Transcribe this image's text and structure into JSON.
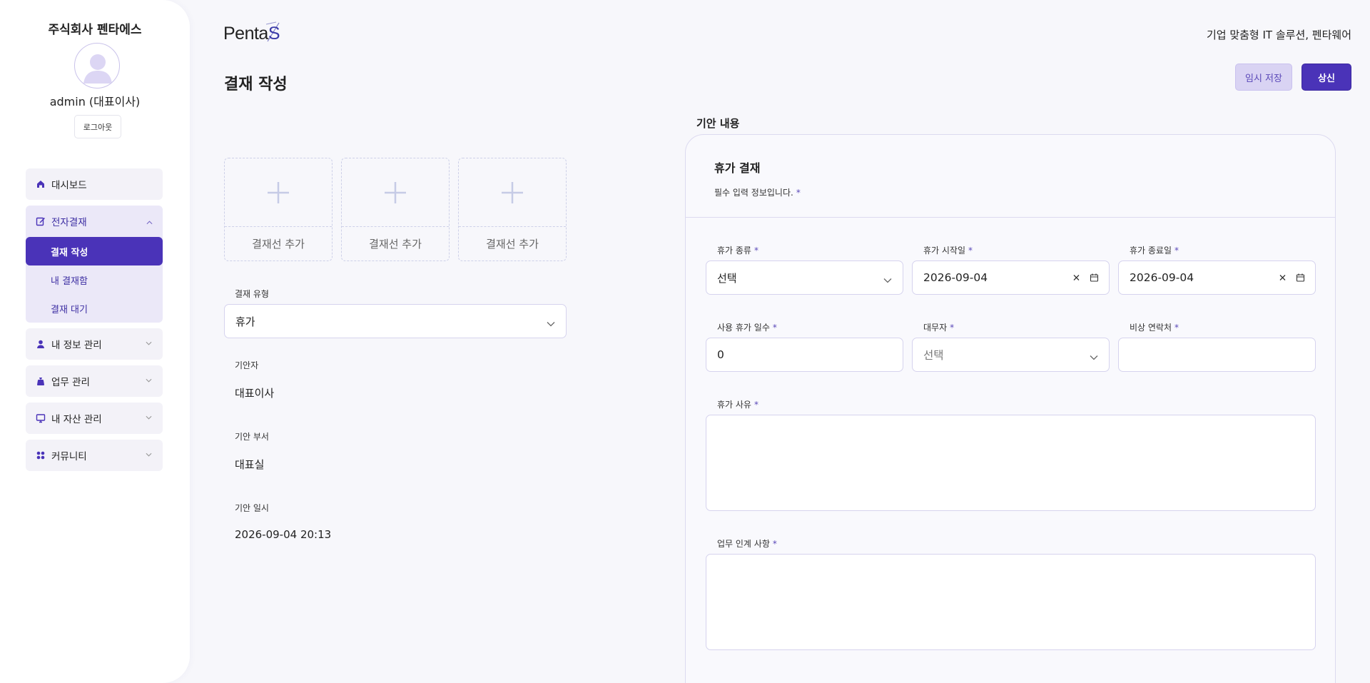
{
  "sidebar": {
    "company": "주식회사 펜타에스",
    "username": "admin (대표이사)",
    "logout_label": "로그아웃",
    "menu": {
      "dashboard": "대시보드",
      "approval": "전자결재",
      "approval_sub": [
        "결재 작성",
        "내 결재함",
        "결재 대기"
      ],
      "my_info": "내 정보 관리",
      "work": "업무 관리",
      "assets": "내 자산 관리",
      "community": "커뮤니티"
    }
  },
  "header": {
    "logo_main": "Penta",
    "logo_accent": "S",
    "tagline": "기업 맞춤형 IT 솔루션, 펜타웨어",
    "page_title": "결재 작성",
    "temp_save_label": "임시 저장",
    "submit_label": "상신"
  },
  "left": {
    "approver_add_labels": [
      "결재선 추가",
      "결재선 추가",
      "결재선 추가"
    ],
    "approval_type_label": "결재 유형",
    "approval_type_value": "휴가",
    "drafter_label": "기안자",
    "drafter_value": "대표이사",
    "dept_label": "기안 부서",
    "dept_value": "대표실",
    "date_label": "기안 일시",
    "date_value": "2026-09-04 20:13"
  },
  "form": {
    "section_title": "기안 내용",
    "card_title": "휴가 결재",
    "required_note": "필수 입력 정보입니다.",
    "required_mark": "*",
    "leave_type_label": "휴가 종류",
    "leave_type_value": "선택",
    "start_label": "휴가 시작일",
    "start_value": "2026-09-04",
    "end_label": "휴가 종료일",
    "end_value": "2026-09-04",
    "days_label": "사용 휴가 일수",
    "days_value": "0",
    "substitute_label": "대무자",
    "substitute_value": "선택",
    "contact_label": "비상 연락처",
    "contact_value": "",
    "reason_label": "휴가 사유",
    "reason_value": "",
    "handover_label": "업무 인계 사항",
    "handover_value": ""
  },
  "colors": {
    "accent": "#4a33b8",
    "accent_light": "#ebe8f8",
    "border": "#d6d3ee"
  }
}
